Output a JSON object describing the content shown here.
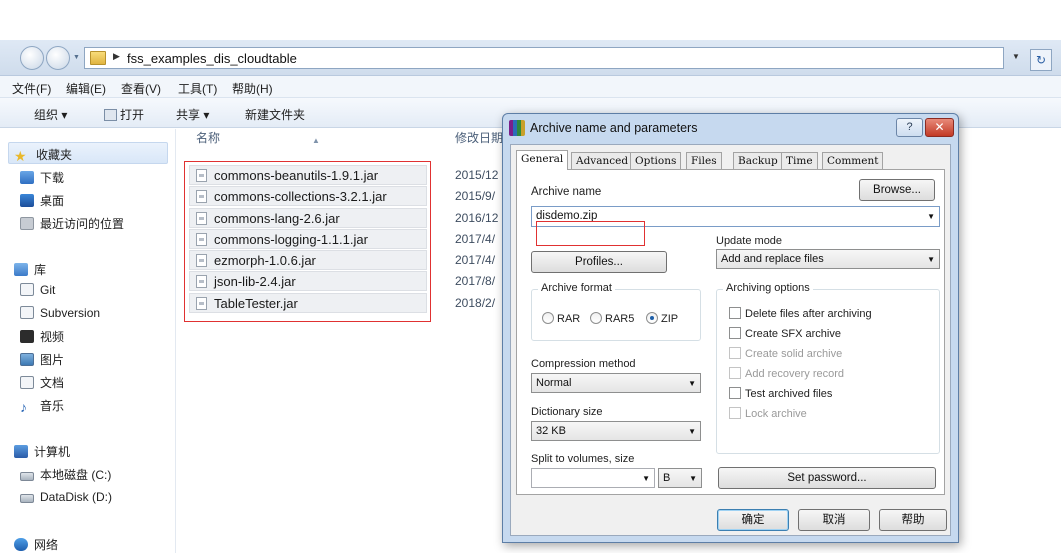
{
  "explorer": {
    "address_path": "fss_examples_dis_cloudtable",
    "menu": [
      "文件(F)",
      "编辑(E)",
      "查看(V)",
      "工具(T)",
      "帮助(H)"
    ],
    "commands": {
      "organize": "组织 ▾",
      "open": "打开",
      "share": "共享 ▾",
      "new_folder": "新建文件夹"
    },
    "nav": {
      "favorites": "收藏夹",
      "downloads": "下载",
      "desktop": "桌面",
      "recent": "最近访问的位置",
      "libraries": "库",
      "git": "Git",
      "subversion": "Subversion",
      "videos": "视频",
      "pictures": "图片",
      "documents": "文档",
      "music": "音乐",
      "computer": "计算机",
      "local_disk": "本地磁盘 (C:)",
      "data_disk": "DataDisk (D:)",
      "network": "网络"
    },
    "columns": {
      "name": "名称",
      "modified": "修改日期"
    },
    "files": [
      {
        "name": "commons-beanutils-1.9.1.jar",
        "date": "2015/12"
      },
      {
        "name": "commons-collections-3.2.1.jar",
        "date": "2015/9/"
      },
      {
        "name": "commons-lang-2.6.jar",
        "date": "2016/12"
      },
      {
        "name": "commons-logging-1.1.1.jar",
        "date": "2017/4/"
      },
      {
        "name": "ezmorph-1.0.6.jar",
        "date": "2017/4/"
      },
      {
        "name": "json-lib-2.4.jar",
        "date": "2017/8/"
      },
      {
        "name": "TableTester.jar",
        "date": "2018/2/"
      }
    ]
  },
  "dialog": {
    "title": "Archive name and parameters",
    "help_glyph": "?",
    "close_glyph": "✕",
    "tabs": [
      "General",
      "Advanced",
      "Options",
      "Files",
      "Backup",
      "Time",
      "Comment"
    ],
    "archive_name_label": "Archive name",
    "archive_name_value": "disdemo.zip",
    "browse_label": "Browse...",
    "update_mode_label": "Update mode",
    "update_mode_value": "Add and replace files",
    "profiles_label": "Profiles...",
    "archive_format_label": "Archive format",
    "formats": [
      "RAR",
      "RAR5",
      "ZIP"
    ],
    "selected_format": "ZIP",
    "compression_label": "Compression method",
    "compression_value": "Normal",
    "dictionary_label": "Dictionary size",
    "dictionary_value": "32 KB",
    "split_label": "Split to volumes, size",
    "split_unit": "B",
    "archiving_options_label": "Archiving options",
    "options": [
      {
        "label": "Delete files after archiving",
        "enabled": true
      },
      {
        "label": "Create SFX archive",
        "enabled": true
      },
      {
        "label": "Create solid archive",
        "enabled": false
      },
      {
        "label": "Add recovery record",
        "enabled": false
      },
      {
        "label": "Test archived files",
        "enabled": true
      },
      {
        "label": "Lock archive",
        "enabled": false
      }
    ],
    "set_password_label": "Set password...",
    "ok_label": "确定",
    "cancel_label": "取消",
    "help_label": "帮助"
  },
  "colors": {
    "highlight_box": "#e03131",
    "dialog_frame": "#c6d9ef",
    "accent": "#1e5fa8"
  }
}
